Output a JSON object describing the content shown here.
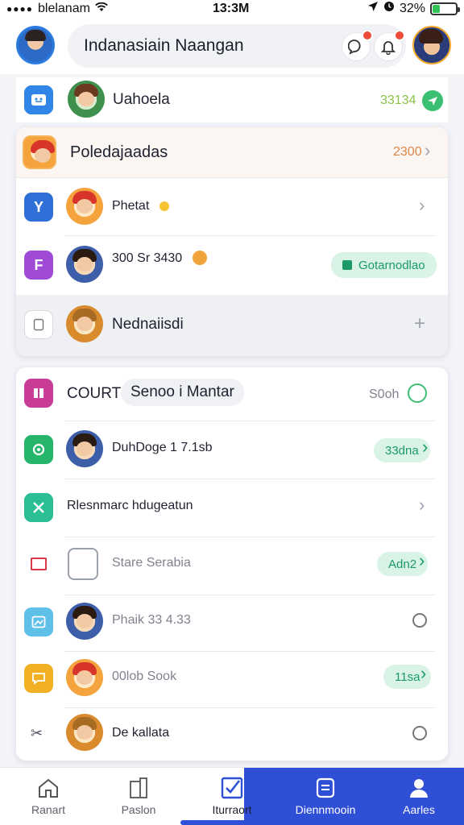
{
  "status_bar": {
    "carrier": "blelanam",
    "time": "13:3M",
    "battery_percent": "32%",
    "battery_level": 0.32
  },
  "header": {
    "search_text": "Indanasiain Naangan",
    "notif_badge_color": "#ef4b3a"
  },
  "top_row": {
    "label": "Uahoela",
    "value": "33134"
  },
  "card1": {
    "title": "Poledajaadas",
    "title_value": "2300",
    "rows": [
      {
        "label": "Phetat"
      },
      {
        "label": "300 Sr 3430",
        "action": "Gotarnodlao"
      },
      {
        "label": "Nednaiisdi"
      }
    ]
  },
  "card2": {
    "rows": [
      {
        "label": "COURT",
        "chip": "Senoo i Mantar",
        "value": "S0oh"
      },
      {
        "label": "DuhDoge 1 7.1sb",
        "badge": "33dna"
      },
      {
        "label": "Rlesnmarc hdugeatun"
      },
      {
        "label": "Stare Serabia",
        "badge": "Adn2"
      },
      {
        "label": "Phaik 33 4.33"
      },
      {
        "label": "00lob Sook",
        "badge": "11sa"
      },
      {
        "label": "De kallata"
      }
    ]
  },
  "bottom_nav": {
    "items": [
      {
        "label": "Ranart",
        "icon": "home-icon"
      },
      {
        "label": "Paslon",
        "icon": "building-icon"
      },
      {
        "label": "Iturraort",
        "icon": "check-square-icon"
      },
      {
        "label": "Diennmooin",
        "icon": "document-icon"
      },
      {
        "label": "Aarles",
        "icon": "person-icon"
      }
    ],
    "active_color": "#2e4fd6"
  }
}
